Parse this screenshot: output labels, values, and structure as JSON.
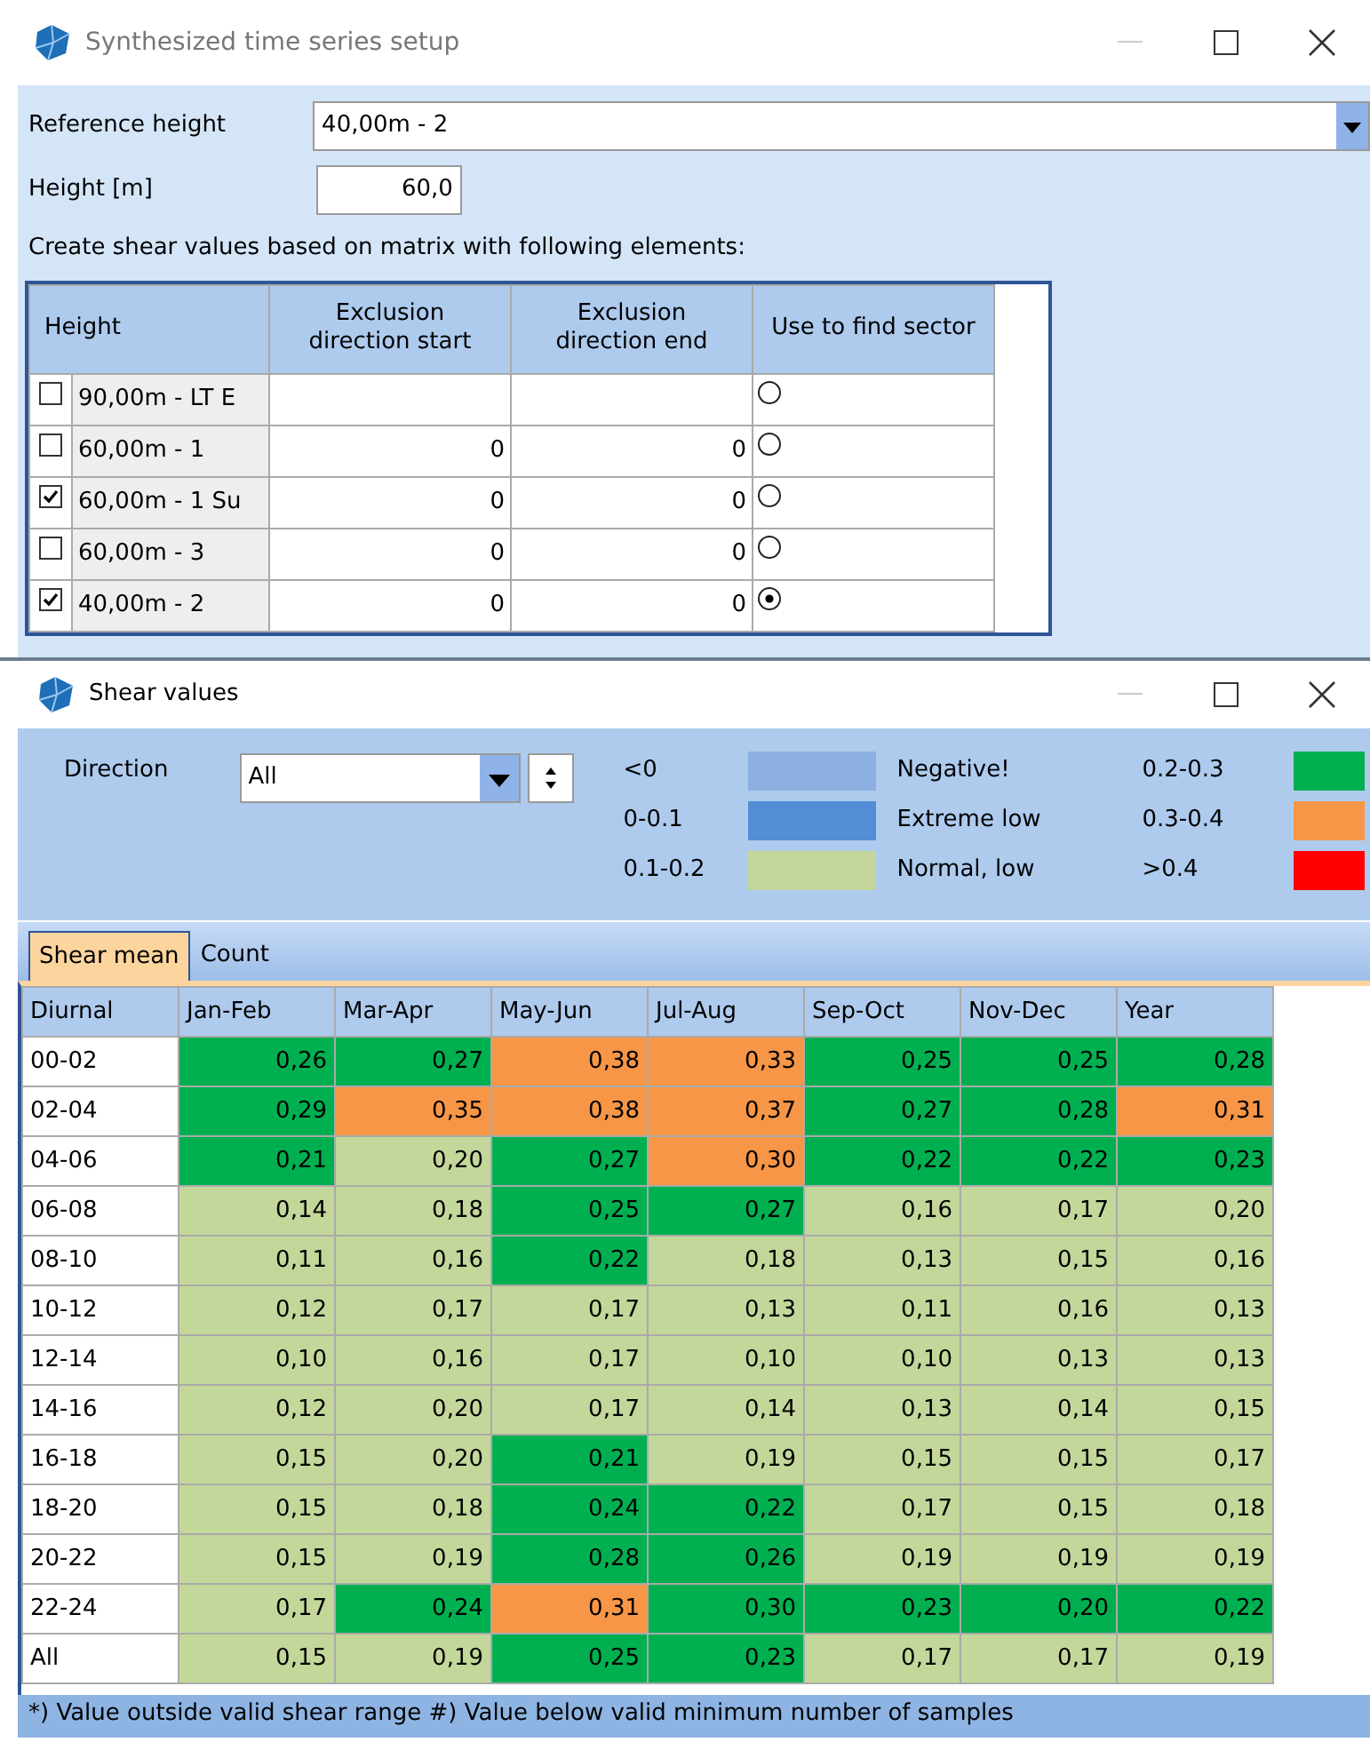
{
  "setup_window": {
    "title": "Synthesized time series setup",
    "reference_height": {
      "label": "Reference height",
      "value": "40,00m - 2"
    },
    "height": {
      "label": "Height [m]",
      "value": "60,0"
    },
    "matrix_caption": "Create shear values based on matrix with following elements:",
    "matrix": {
      "columns": [
        "Height",
        "Exclusion direction start",
        "Exclusion direction end",
        "Use to find sector"
      ],
      "rows": [
        {
          "checked": false,
          "height": "90,00m - LT E",
          "start": "",
          "end": "",
          "selected": false
        },
        {
          "checked": false,
          "height": "60,00m - 1",
          "start": "0",
          "end": "0",
          "selected": false
        },
        {
          "checked": true,
          "height": "60,00m - 1 Su",
          "start": "0",
          "end": "0",
          "selected": false
        },
        {
          "checked": false,
          "height": "60,00m - 3",
          "start": "0",
          "end": "0",
          "selected": false
        },
        {
          "checked": true,
          "height": "40,00m - 2",
          "start": "0",
          "end": "0",
          "selected": true
        }
      ]
    }
  },
  "shear_window": {
    "title": "Shear values",
    "direction": {
      "label": "Direction",
      "value": "All"
    },
    "legend": [
      {
        "range": "<0",
        "color": "#8db0e2",
        "label": "Negative!"
      },
      {
        "range": "0.2-0.3",
        "color": "#00b050"
      },
      {
        "range": "0-0.1",
        "color": "#538dd5",
        "label": "Extreme low"
      },
      {
        "range": "0.3-0.4",
        "color": "#f79646"
      },
      {
        "range": "0.1-0.2",
        "color": "#c4d79b",
        "label": "Normal, low"
      },
      {
        "range": ">0.4",
        "color": "#ff0000"
      }
    ],
    "tabs": [
      {
        "label": "Shear mean",
        "selected": true
      },
      {
        "label": "Count",
        "selected": false
      }
    ],
    "table": {
      "columns": [
        "Diurnal",
        "Jan-Feb",
        "Mar-Apr",
        "May-Jun",
        "Jul-Aug",
        "Sep-Oct",
        "Nov-Dec",
        "Year"
      ],
      "rows": [
        {
          "cells": [
            {
              "text": "00-02"
            },
            {
              "text": "0,26",
              "color": "#00b050"
            },
            {
              "text": "0,27",
              "color": "#00b050"
            },
            {
              "text": "0,38",
              "color": "#f79646"
            },
            {
              "text": "0,33",
              "color": "#f79646"
            },
            {
              "text": "0,25",
              "color": "#00b050"
            },
            {
              "text": "0,25",
              "color": "#00b050"
            },
            {
              "text": "0,28",
              "color": "#00b050"
            }
          ]
        },
        {
          "cells": [
            {
              "text": "02-04"
            },
            {
              "text": "0,29",
              "color": "#00b050"
            },
            {
              "text": "0,35",
              "color": "#f79646"
            },
            {
              "text": "0,38",
              "color": "#f79646"
            },
            {
              "text": "0,37",
              "color": "#f79646"
            },
            {
              "text": "0,27",
              "color": "#00b050"
            },
            {
              "text": "0,28",
              "color": "#00b050"
            },
            {
              "text": "0,31",
              "color": "#f79646"
            }
          ]
        },
        {
          "cells": [
            {
              "text": "04-06"
            },
            {
              "text": "0,21",
              "color": "#00b050"
            },
            {
              "text": "0,20",
              "color": "#c4d79b"
            },
            {
              "text": "0,27",
              "color": "#00b050"
            },
            {
              "text": "0,30",
              "color": "#f79646"
            },
            {
              "text": "0,22",
              "color": "#00b050"
            },
            {
              "text": "0,22",
              "color": "#00b050"
            },
            {
              "text": "0,23",
              "color": "#00b050"
            }
          ]
        },
        {
          "cells": [
            {
              "text": "06-08"
            },
            {
              "text": "0,14",
              "color": "#c4d79b"
            },
            {
              "text": "0,18",
              "color": "#c4d79b"
            },
            {
              "text": "0,25",
              "color": "#00b050"
            },
            {
              "text": "0,27",
              "color": "#00b050"
            },
            {
              "text": "0,16",
              "color": "#c4d79b"
            },
            {
              "text": "0,17",
              "color": "#c4d79b"
            },
            {
              "text": "0,20",
              "color": "#c4d79b"
            }
          ]
        },
        {
          "cells": [
            {
              "text": "08-10"
            },
            {
              "text": "0,11",
              "color": "#c4d79b"
            },
            {
              "text": "0,16",
              "color": "#c4d79b"
            },
            {
              "text": "0,22",
              "color": "#00b050"
            },
            {
              "text": "0,18",
              "color": "#c4d79b"
            },
            {
              "text": "0,13",
              "color": "#c4d79b"
            },
            {
              "text": "0,15",
              "color": "#c4d79b"
            },
            {
              "text": "0,16",
              "color": "#c4d79b"
            }
          ]
        },
        {
          "cells": [
            {
              "text": "10-12"
            },
            {
              "text": "0,12",
              "color": "#c4d79b"
            },
            {
              "text": "0,17",
              "color": "#c4d79b"
            },
            {
              "text": "0,17",
              "color": "#c4d79b"
            },
            {
              "text": "0,13",
              "color": "#c4d79b"
            },
            {
              "text": "0,11",
              "color": "#c4d79b"
            },
            {
              "text": "0,16",
              "color": "#c4d79b"
            },
            {
              "text": "0,13",
              "color": "#c4d79b"
            }
          ]
        },
        {
          "cells": [
            {
              "text": "12-14"
            },
            {
              "text": "0,10",
              "color": "#c4d79b"
            },
            {
              "text": "0,16",
              "color": "#c4d79b"
            },
            {
              "text": "0,17",
              "color": "#c4d79b"
            },
            {
              "text": "0,10",
              "color": "#c4d79b"
            },
            {
              "text": "0,10",
              "color": "#c4d79b"
            },
            {
              "text": "0,13",
              "color": "#c4d79b"
            },
            {
              "text": "0,13",
              "color": "#c4d79b"
            }
          ]
        },
        {
          "cells": [
            {
              "text": "14-16"
            },
            {
              "text": "0,12",
              "color": "#c4d79b"
            },
            {
              "text": "0,20",
              "color": "#c4d79b"
            },
            {
              "text": "0,17",
              "color": "#c4d79b"
            },
            {
              "text": "0,14",
              "color": "#c4d79b"
            },
            {
              "text": "0,13",
              "color": "#c4d79b"
            },
            {
              "text": "0,14",
              "color": "#c4d79b"
            },
            {
              "text": "0,15",
              "color": "#c4d79b"
            }
          ]
        },
        {
          "cells": [
            {
              "text": "16-18"
            },
            {
              "text": "0,15",
              "color": "#c4d79b"
            },
            {
              "text": "0,20",
              "color": "#c4d79b"
            },
            {
              "text": "0,21",
              "color": "#00b050"
            },
            {
              "text": "0,19",
              "color": "#c4d79b"
            },
            {
              "text": "0,15",
              "color": "#c4d79b"
            },
            {
              "text": "0,15",
              "color": "#c4d79b"
            },
            {
              "text": "0,17",
              "color": "#c4d79b"
            }
          ]
        },
        {
          "cells": [
            {
              "text": "18-20"
            },
            {
              "text": "0,15",
              "color": "#c4d79b"
            },
            {
              "text": "0,18",
              "color": "#c4d79b"
            },
            {
              "text": "0,24",
              "color": "#00b050"
            },
            {
              "text": "0,22",
              "color": "#00b050"
            },
            {
              "text": "0,17",
              "color": "#c4d79b"
            },
            {
              "text": "0,15",
              "color": "#c4d79b"
            },
            {
              "text": "0,18",
              "color": "#c4d79b"
            }
          ]
        },
        {
          "cells": [
            {
              "text": "20-22"
            },
            {
              "text": "0,15",
              "color": "#c4d79b"
            },
            {
              "text": "0,19",
              "color": "#c4d79b"
            },
            {
              "text": "0,28",
              "color": "#00b050"
            },
            {
              "text": "0,26",
              "color": "#00b050"
            },
            {
              "text": "0,19",
              "color": "#c4d79b"
            },
            {
              "text": "0,19",
              "color": "#c4d79b"
            },
            {
              "text": "0,19",
              "color": "#c4d79b"
            }
          ]
        },
        {
          "cells": [
            {
              "text": "22-24"
            },
            {
              "text": "0,17",
              "color": "#c4d79b"
            },
            {
              "text": "0,24",
              "color": "#00b050"
            },
            {
              "text": "0,31",
              "color": "#f79646"
            },
            {
              "text": "0,30",
              "color": "#00b050"
            },
            {
              "text": "0,23",
              "color": "#00b050"
            },
            {
              "text": "0,20",
              "color": "#00b050"
            },
            {
              "text": "0,22",
              "color": "#00b050"
            }
          ]
        },
        {
          "cells": [
            {
              "text": "All"
            },
            {
              "text": "0,15",
              "color": "#c4d79b"
            },
            {
              "text": "0,19",
              "color": "#c4d79b"
            },
            {
              "text": "0,25",
              "color": "#00b050"
            },
            {
              "text": "0,23",
              "color": "#00b050"
            },
            {
              "text": "0,17",
              "color": "#c4d79b"
            },
            {
              "text": "0,17",
              "color": "#c4d79b"
            },
            {
              "text": "0,19",
              "color": "#c4d79b"
            }
          ]
        }
      ]
    },
    "status_bar": "*) Value outside valid shear range  #) Value below valid minimum number of samples"
  }
}
